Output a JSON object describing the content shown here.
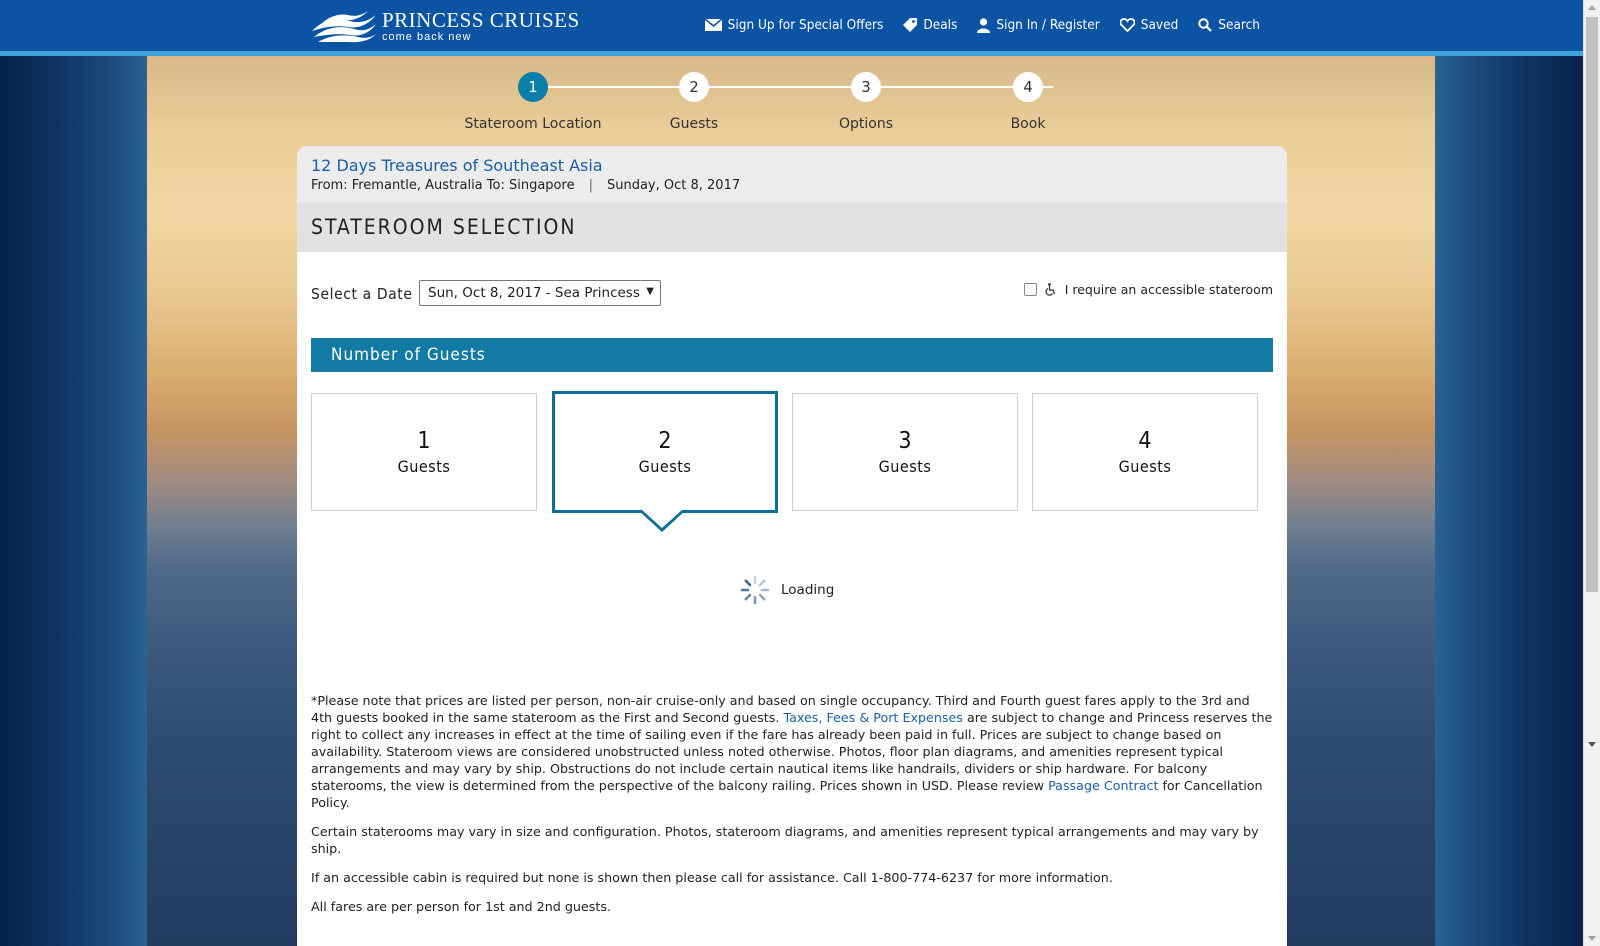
{
  "header": {
    "logo_title": "PRINCESS CRUISES",
    "logo_subtitle": "come back new",
    "nav": [
      {
        "label": "Sign Up for Special Offers",
        "icon": "envelope-icon"
      },
      {
        "label": "Deals",
        "icon": "tag-icon"
      },
      {
        "label": "Sign In / Register",
        "icon": "user-icon"
      },
      {
        "label": "Saved",
        "icon": "heart-icon"
      },
      {
        "label": "Search",
        "icon": "search-icon"
      }
    ]
  },
  "stepper": {
    "steps": [
      {
        "number": "1",
        "label": "Stateroom Location",
        "active": true
      },
      {
        "number": "2",
        "label": "Guests",
        "active": false
      },
      {
        "number": "3",
        "label": "Options",
        "active": false
      },
      {
        "number": "4",
        "label": "Book",
        "active": false
      }
    ]
  },
  "cruise": {
    "title": "12 Days Treasures of Southeast Asia",
    "route": "From: Fremantle, Australia To: Singapore",
    "separator": "|",
    "date": "Sunday, Oct 8, 2017"
  },
  "section_title": "STATEROOM SELECTION",
  "date_select": {
    "label": "Select a Date",
    "value": "Sun, Oct 8, 2017 - Sea Princess",
    "caret": "▼"
  },
  "accessible": {
    "label": "I require an accessible stateroom",
    "checked": false
  },
  "guests": {
    "title": "Number of Guests",
    "options": [
      {
        "num": "1",
        "label": "Guests"
      },
      {
        "num": "2",
        "label": "Guests"
      },
      {
        "num": "3",
        "label": "Guests"
      },
      {
        "num": "4",
        "label": "Guests"
      }
    ],
    "selected_index": 1
  },
  "loading_text": "Loading",
  "notes": {
    "p1_a": "*Please note that prices are listed per person, non-air cruise-only and based on single occupancy. Third and Fourth guest fares apply to the 3rd and 4th guests booked in the same stateroom as the First and Second guests. ",
    "p1_link1": "Taxes, Fees & Port Expenses",
    "p1_b": " are subject to change and Princess reserves the right to collect any increases in effect at the time of sailing even if the fare has already been paid in full. Prices are subject to change based on availability. Stateroom views are considered unobstructed unless noted otherwise. Photos, floor plan diagrams, and amenities represent typical arrangements and may vary by ship. Obstructions do not include certain nautical items like handrails, dividers or ship hardware. For balcony staterooms, the view is determined from the perspective of the balcony railing. Prices shown in USD. Please review ",
    "p1_link2": "Passage Contract",
    "p1_c": " for Cancellation Policy.",
    "p2": "Certain staterooms may vary in size and configuration. Photos, stateroom diagrams, and amenities represent typical arrangements and may vary by ship.",
    "p3": "If an accessible cabin is required but none is shown then please call for assistance. Call 1-800-774-6237 for more information.",
    "p4": "All fares are per person for 1st and 2nd guests."
  },
  "colors": {
    "header_bg": "#0a54a3",
    "header_border": "#3fa2dc",
    "accent": "#127aa4",
    "selected_border": "#0a6f9a",
    "link": "#1a5ea6"
  }
}
